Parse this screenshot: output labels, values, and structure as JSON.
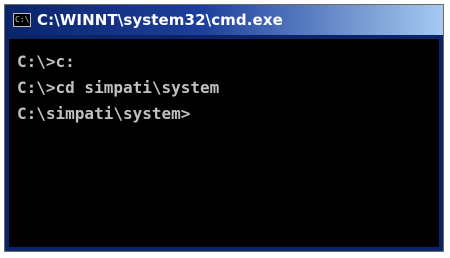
{
  "window": {
    "title": "C:\\WINNT\\system32\\cmd.exe",
    "icon": "cmd-window-icon",
    "icon_glyph": "C:\\"
  },
  "console": {
    "lines": [
      "C:\\>c:",
      "C:\\>cd simpati\\system",
      "C:\\simpati\\system>"
    ]
  },
  "colors": {
    "titlebar_start": "#0a246a",
    "titlebar_end": "#a6caf0",
    "console_bg": "#000000",
    "console_text": "#c0c0c0"
  }
}
